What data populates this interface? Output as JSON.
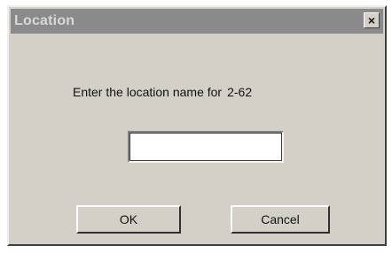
{
  "window": {
    "title": "Location",
    "close_glyph": "×"
  },
  "prompt": {
    "text": "Enter the location name for",
    "target": "2-62"
  },
  "input": {
    "value": "",
    "placeholder": ""
  },
  "buttons": {
    "ok_label": "OK",
    "cancel_label": "Cancel"
  },
  "colors": {
    "dialog_face": "#d4d0c8",
    "titlebar_inactive": "#8a8a8a"
  },
  "icons": {
    "close": "close-icon"
  }
}
